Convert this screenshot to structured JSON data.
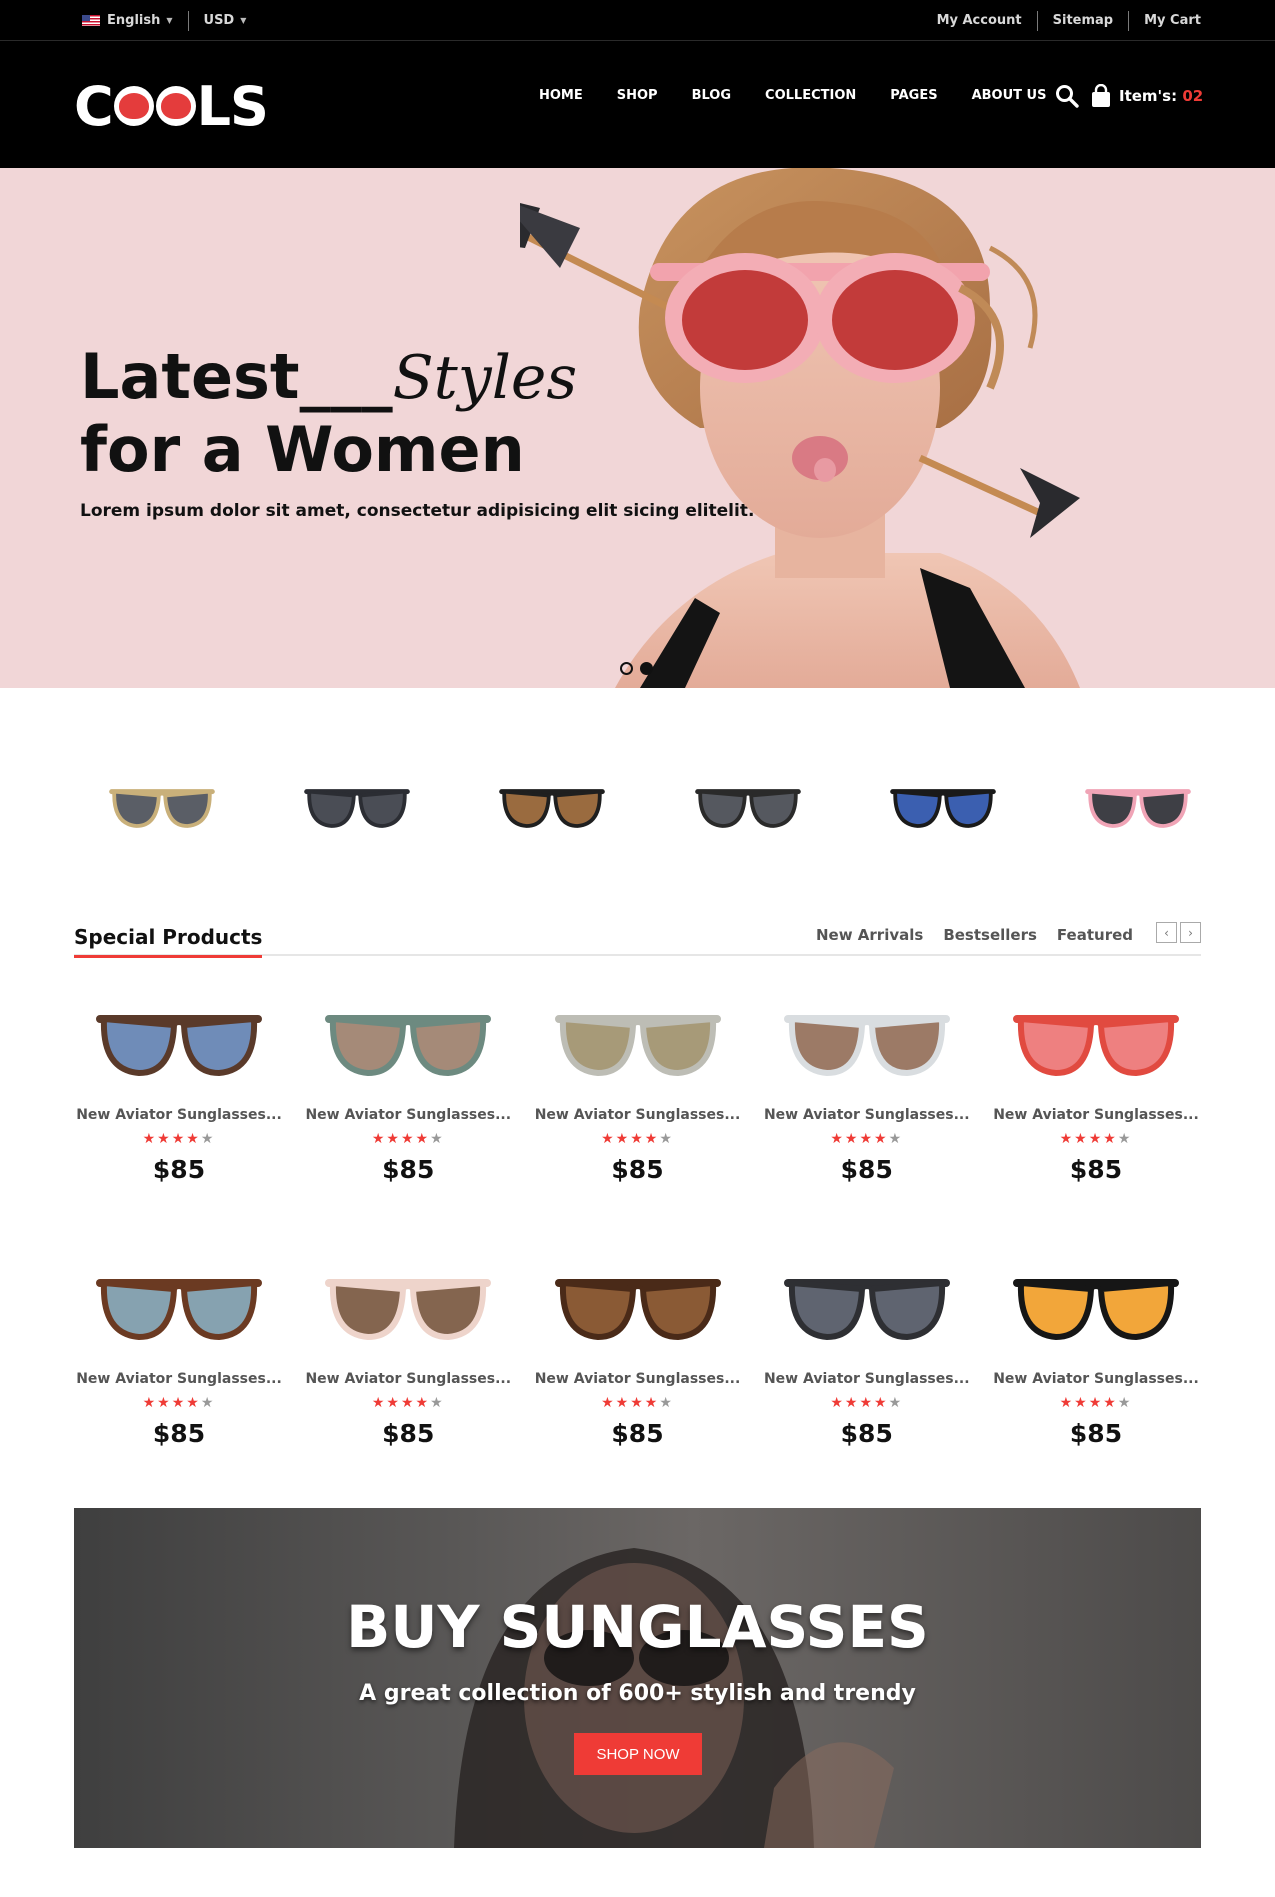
{
  "topbar": {
    "language": "English",
    "currency": "USD",
    "links": [
      "My Account",
      "Sitemap",
      "My Cart"
    ]
  },
  "header": {
    "logo": "COOLS",
    "nav": [
      "HOME",
      "SHOP",
      "BLOG",
      "COLLECTION",
      "PAGES",
      "ABOUT US"
    ],
    "cart_label": "Item's:",
    "cart_count": "02"
  },
  "hero": {
    "title_bold": "Latest",
    "title_dashes": "___",
    "title_script": "Styles",
    "title_line2": "for a Women",
    "subtitle": "Lorem ipsum dolor sit amet, consectetur adipisicing elit sicing elitelit.",
    "slides": 2,
    "active_slide": 2
  },
  "brands": [
    {
      "icon": "aviator-grey-sunglasses-icon",
      "lens": "#5a5e66",
      "frame": "#c9b07a"
    },
    {
      "icon": "round-dark-sunglasses-icon",
      "lens": "#4a4d55",
      "frame": "#2b2d33"
    },
    {
      "icon": "wayfarer-brown-sunglasses-icon",
      "lens": "#9a6b3f",
      "frame": "#1f1f1f"
    },
    {
      "icon": "wayfarer-grey-sunglasses-icon",
      "lens": "#55585f",
      "frame": "#2a2a2a"
    },
    {
      "icon": "wayfarer-blue-sunglasses-icon",
      "lens": "#3b5fb0",
      "frame": "#1a1a1a"
    },
    {
      "icon": "round-pink-sunglasses-icon",
      "lens": "#3e3f45",
      "frame": "#f0a4b6"
    }
  ],
  "special": {
    "title": "Special Products",
    "tabs": [
      "New Arrivals",
      "Bestsellers",
      "Featured"
    ],
    "prev": "‹",
    "next": "›"
  },
  "products": [
    {
      "name": "New Aviator Sunglasses...",
      "rating": 4,
      "price": "$85",
      "lens": "#6f8cb8",
      "frame": "#5a3a2a"
    },
    {
      "name": "New Aviator Sunglasses...",
      "rating": 4,
      "price": "$85",
      "lens": "#a58a78",
      "frame": "#6d8a80"
    },
    {
      "name": "New Aviator Sunglasses...",
      "rating": 4,
      "price": "$85",
      "lens": "#a79a78",
      "frame": "#bdbdb5"
    },
    {
      "name": "New Aviator Sunglasses...",
      "rating": 4,
      "price": "$85",
      "lens": "#9c7a66",
      "frame": "#d9dde0"
    },
    {
      "name": "New Aviator Sunglasses...",
      "rating": 4,
      "price": "$85",
      "lens": "#ee8080",
      "frame": "#e14a40"
    },
    {
      "name": "New Aviator Sunglasses...",
      "rating": 4,
      "price": "$85",
      "lens": "#86a2b0",
      "frame": "#6b3a22"
    },
    {
      "name": "New Aviator Sunglasses...",
      "rating": 4,
      "price": "$85",
      "lens": "#84654f",
      "frame": "#eed4cb"
    },
    {
      "name": "New Aviator Sunglasses...",
      "rating": 4,
      "price": "$85",
      "lens": "#8a5a35",
      "frame": "#4a2a18"
    },
    {
      "name": "New Aviator Sunglasses...",
      "rating": 4,
      "price": "$85",
      "lens": "#5f6470",
      "frame": "#2e2f33"
    },
    {
      "name": "New Aviator Sunglasses...",
      "rating": 4,
      "price": "$85",
      "lens": "#f2a63a",
      "frame": "#161616"
    }
  ],
  "banner": {
    "title": "BUY SUNGLASSES",
    "subtitle": "A great collection of 600+ stylish and trendy",
    "button": "SHOP NOW"
  },
  "colors": {
    "accent": "#ef3b36",
    "hero_bg": "#f1d6d7",
    "header_bg": "#000000"
  }
}
